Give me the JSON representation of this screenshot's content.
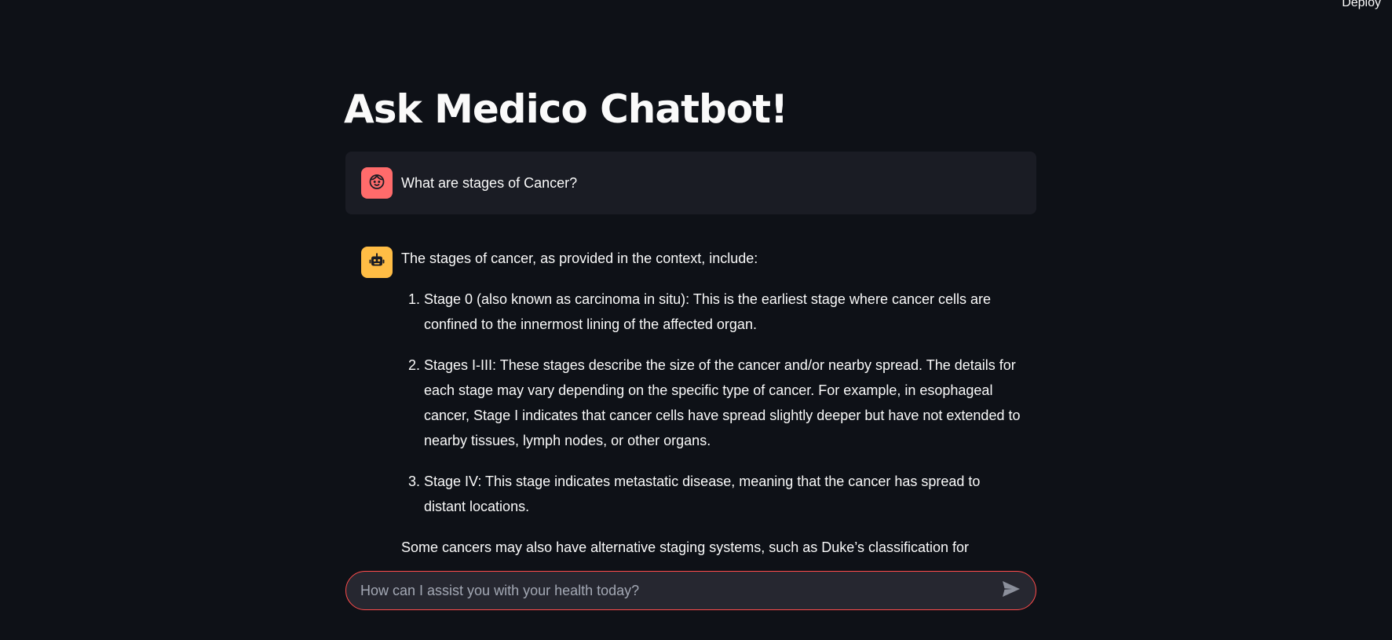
{
  "header": {
    "deploy_label": "Deploy"
  },
  "page": {
    "title": "Ask Medico Chatbot!"
  },
  "messages": [
    {
      "role": "user",
      "avatar_icon": "user-face-icon",
      "text": "What are stages of Cancer?"
    },
    {
      "role": "assistant",
      "avatar_icon": "robot-icon",
      "intro": "The stages of cancer, as provided in the context, include:",
      "items": [
        "Stage 0 (also known as carcinoma in situ): This is the earliest stage where cancer cells are confined to the innermost lining of the affected organ.",
        "Stages I-III: These stages describe the size of the cancer and/or nearby spread. The details for each stage may vary depending on the specific type of cancer. For example, in esophageal cancer, Stage I indicates that cancer cells have spread slightly deeper but have not extended to nearby tissues, lymph nodes, or other organs.",
        "Stage IV: This stage indicates metastatic disease, meaning that the cancer has spread to distant locations."
      ],
      "outro": "Some cancers may also have alternative staging systems, such as Duke’s classification for"
    }
  ],
  "chat_input": {
    "placeholder": "How can I assist you with your health today?",
    "value": "",
    "send_icon": "send-icon"
  },
  "colors": {
    "background": "#0e1117",
    "user_bubble": "#1a1c24",
    "user_avatar": "#ff6b6b",
    "bot_avatar": "#ffbd45",
    "input_border": "#ff4b4b",
    "input_background": "#262730"
  }
}
